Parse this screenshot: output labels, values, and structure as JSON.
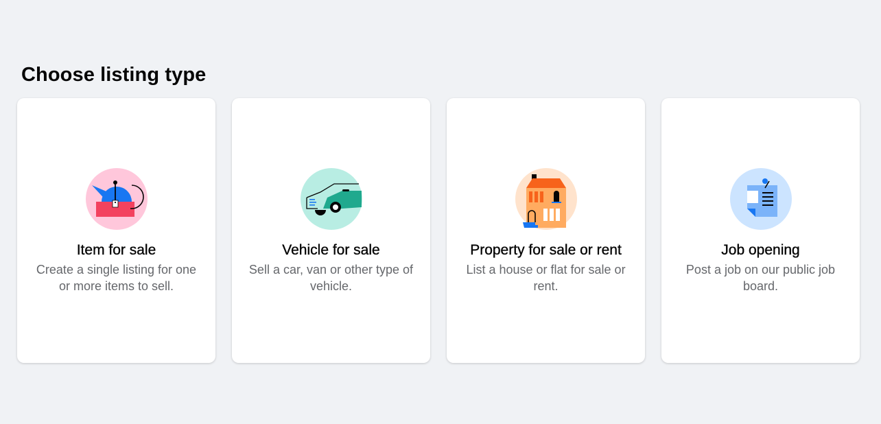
{
  "page": {
    "title": "Choose listing type"
  },
  "cards": [
    {
      "title": "Item for sale",
      "description": "Create a single listing for one or more items to sell.",
      "icon": "price-tag-item-icon",
      "circle_color": "#ffc7db"
    },
    {
      "title": "Vehicle for sale",
      "description": "Sell a car, van or other type of vehicle.",
      "icon": "car-icon",
      "circle_color": "#b8ede3"
    },
    {
      "title": "Property for sale or rent",
      "description": "List a house or flat for sale or rent.",
      "icon": "house-icon",
      "circle_color": "#ffe3cc"
    },
    {
      "title": "Job opening",
      "description": "Post a job on our public job board.",
      "icon": "job-notepad-icon",
      "circle_color": "#cce4ff"
    }
  ]
}
